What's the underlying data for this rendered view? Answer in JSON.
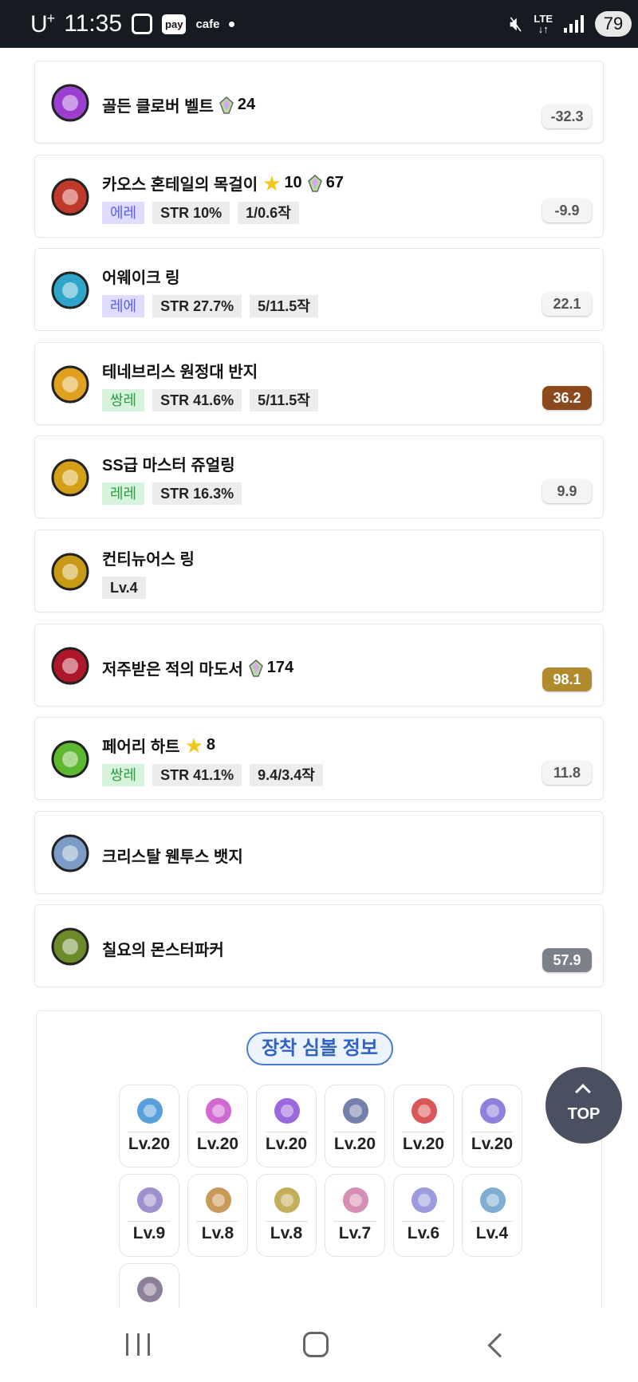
{
  "status_bar": {
    "carrier": "U",
    "carrier_sup": "+",
    "time": "11:35",
    "pay": "pay",
    "cafe": "cafe",
    "network": "LTE",
    "battery": "79"
  },
  "items": [
    {
      "name": "골든 클로버 벨트",
      "gem": "24",
      "score": "-32.3",
      "score_style": "normal",
      "icon_color": "#9b3fd0"
    },
    {
      "name": "카오스 혼테일의 목걸이",
      "star": "10",
      "gem": "67",
      "grade": "에레",
      "stat": "STR 10%",
      "extra": "1/0.6작",
      "score": "-9.9",
      "score_style": "normal",
      "icon_color": "#c0392b"
    },
    {
      "name": "어웨이크 링",
      "grade": "레에",
      "stat": "STR 27.7%",
      "extra": "5/11.5작",
      "score": "22.1",
      "score_style": "normal",
      "icon_color": "#2fa6c9"
    },
    {
      "name": "테네브리스 원정대 반지",
      "grade": "쌍레",
      "stat": "STR 41.6%",
      "extra": "5/11.5작",
      "score": "36.2",
      "score_style": "brown",
      "icon_color": "#e0a020"
    },
    {
      "name": "SS급 마스터 쥬얼링",
      "grade": "레레",
      "stat": "STR 16.3%",
      "score": "9.9",
      "score_style": "normal",
      "icon_color": "#d4a017"
    },
    {
      "name": "컨티뉴어스 링",
      "level": "Lv.4",
      "icon_color": "#c99a14"
    },
    {
      "name": "저주받은 적의 마도서",
      "gem": "174",
      "score": "98.1",
      "score_style": "gold",
      "icon_color": "#b0162a"
    },
    {
      "name": "페어리 하트",
      "star": "8",
      "grade": "쌍레",
      "stat": "STR 41.1%",
      "extra": "9.4/3.4작",
      "score": "11.8",
      "score_style": "normal",
      "icon_color": "#5cb82e"
    },
    {
      "name": "크리스탈 웬투스 뱃지",
      "icon_color": "#7a9cc6"
    },
    {
      "name": "칠요의 몬스터파커",
      "score": "57.9",
      "score_style": "gray",
      "icon_color": "#6b8a2a"
    }
  ],
  "symbols": {
    "title": "장착 심볼 정보",
    "arcane": [
      {
        "level": "Lv.20",
        "color": "#3b8fd6"
      },
      {
        "level": "Lv.20",
        "color": "#c84fc9"
      },
      {
        "level": "Lv.20",
        "color": "#8a4fd8"
      },
      {
        "level": "Lv.20",
        "color": "#5a6a9a"
      },
      {
        "level": "Lv.20",
        "color": "#d23a3a"
      },
      {
        "level": "Lv.20",
        "color": "#7a6ad6"
      }
    ],
    "authentic": [
      {
        "level": "Lv.9",
        "color": "#8c7cc4"
      },
      {
        "level": "Lv.8",
        "color": "#c0883a"
      },
      {
        "level": "Lv.8",
        "color": "#b8a040"
      },
      {
        "level": "Lv.7",
        "color": "#d07aa8"
      },
      {
        "level": "Lv.6",
        "color": "#8a8ad8"
      },
      {
        "level": "Lv.4",
        "color": "#6aa0c8"
      },
      {
        "level": "",
        "color": "#7a6a8a"
      }
    ]
  },
  "top_button": {
    "label": "TOP"
  }
}
